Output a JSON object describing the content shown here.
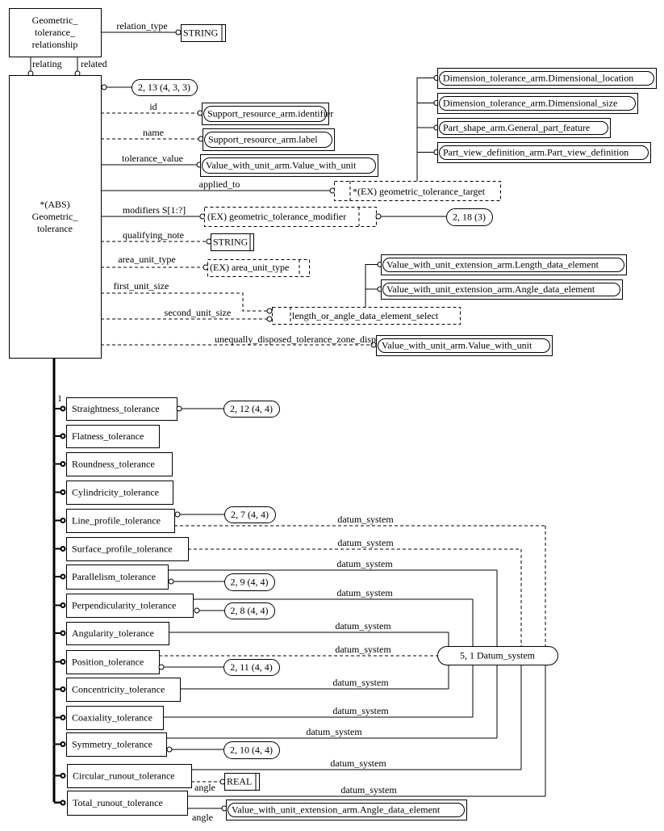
{
  "colors": {
    "line": "#000000",
    "background": "#ffffff"
  },
  "relationship_entity": {
    "lines": [
      "Geometric_",
      "tolerance_",
      "relationship"
    ]
  },
  "relation_type": {
    "label": "relation_type",
    "type": "STRING"
  },
  "relating_label": "relating",
  "related_label": "related",
  "main_entity": {
    "lines": [
      "*(ABS)",
      "Geometric_",
      "tolerance"
    ]
  },
  "main_ref": "2, 13 (4, 3, 3)",
  "attributes": [
    {
      "label": "id",
      "target": "Support_resource_arm.identifier"
    },
    {
      "label": "name",
      "target": "Support_resource_arm.label"
    },
    {
      "label": "tolerance_value",
      "target": "Value_with_unit_arm.Value_with_unit"
    },
    {
      "label": "applied_to",
      "target": "*(EX) geometric_tolerance_target"
    },
    {
      "label": "modifiers S[1:?]",
      "target": "(EX) geometric_tolerance_modifier",
      "ref": "2, 18 (3)"
    },
    {
      "label": "qualifying_note",
      "target": "STRING"
    },
    {
      "label": "area_unit_type",
      "target": "(EX) area_unit_type"
    },
    {
      "label": "first_unit_size",
      "target": "length_or_angle_data_element_select"
    },
    {
      "label": "second_unit_size"
    },
    {
      "label": "unequally_disposed_tolerance_zone_displacement",
      "target": "Value_with_unit_arm.Value_with_unit"
    }
  ],
  "target_select_items": [
    "Dimension_tolerance_arm.Dimensional_location",
    "Dimension_tolerance_arm.Dimensional_size",
    "Part_shape_arm.General_part_feature",
    "Part_view_definition_arm.Part_view_definition"
  ],
  "length_angle_select_items": [
    "Value_with_unit_extension_arm.Length_data_element",
    "Value_with_unit_extension_arm.Angle_data_element"
  ],
  "subtype_cardinality": "1",
  "subtypes": [
    {
      "name": "Straightness_tolerance",
      "ref": "2, 12 (4, 4)"
    },
    {
      "name": "Flatness_tolerance"
    },
    {
      "name": "Roundness_tolerance"
    },
    {
      "name": "Cylindricity_tolerance"
    },
    {
      "name": "Line_profile_tolerance",
      "ref": "2, 7 (4, 4)",
      "datum": "datum_system"
    },
    {
      "name": "Surface_profile_tolerance",
      "datum": "datum_system"
    },
    {
      "name": "Parallelism_tolerance",
      "ref": "2, 9 (4, 4)",
      "datum": "datum_system"
    },
    {
      "name": "Perpendicularity_tolerance",
      "ref": "2, 8 (4, 4)",
      "datum": "datum_system"
    },
    {
      "name": "Angularity_tolerance",
      "datum": "datum_system"
    },
    {
      "name": "Position_tolerance",
      "ref": "2, 11 (4, 4)",
      "datum": "datum_system"
    },
    {
      "name": "Concentricity_tolerance",
      "datum": "datum_system"
    },
    {
      "name": "Coaxiality_tolerance",
      "datum": "datum_system"
    },
    {
      "name": "Symmetry_tolerance",
      "ref": "2, 10 (4, 4)",
      "datum": "datum_system"
    },
    {
      "name": "Circular_runout_tolerance",
      "datum": "datum_system",
      "angle_label": "angle",
      "angle_type": "REAL"
    },
    {
      "name": "Total_runout_tolerance",
      "datum": "datum_system",
      "angle_label": "angle",
      "angle_type": "Value_with_unit_extension_arm.Angle_data_element"
    }
  ],
  "datum_system_ref": "5, 1 Datum_system"
}
